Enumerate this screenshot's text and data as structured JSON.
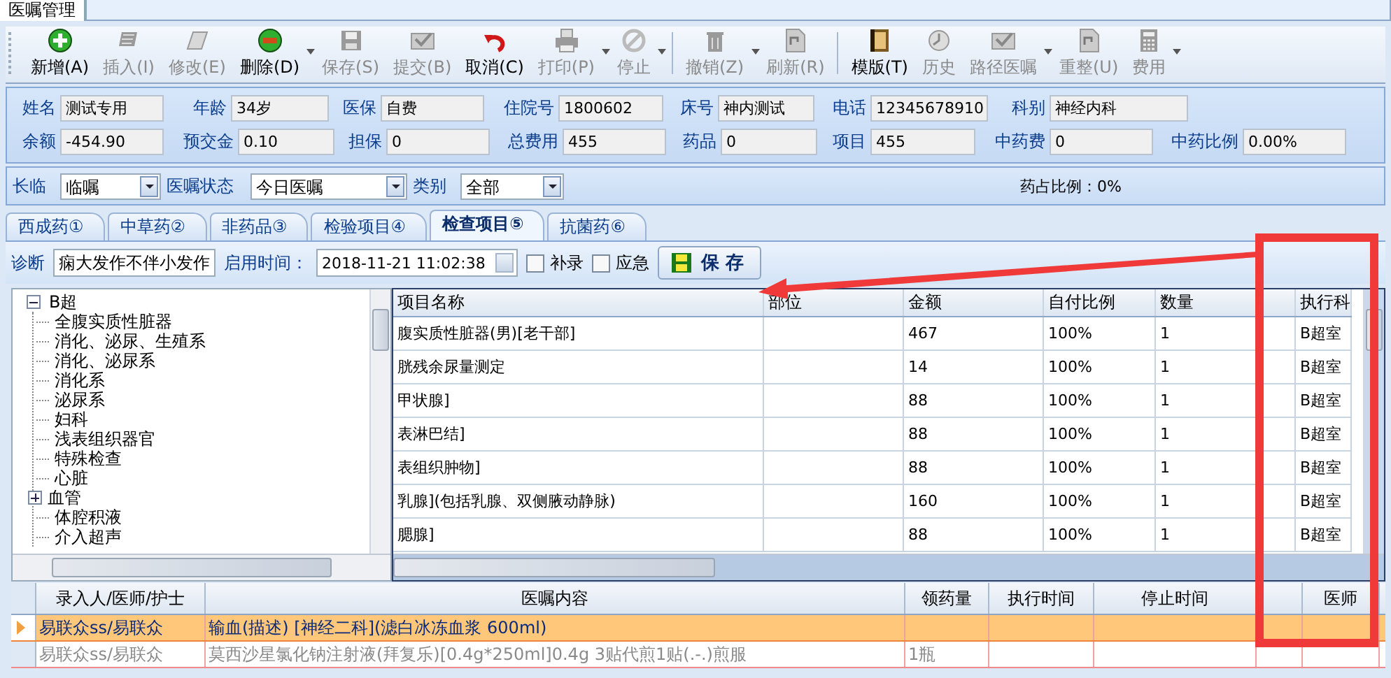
{
  "window": {
    "tab": "医嘱管理"
  },
  "toolbar": [
    {
      "label": "新增(A)",
      "disabled": false,
      "dropdown": false
    },
    {
      "label": "插入(I)",
      "disabled": true,
      "dropdown": false
    },
    {
      "label": "修改(E)",
      "disabled": true,
      "dropdown": false
    },
    {
      "label": "删除(D)",
      "disabled": false,
      "dropdown": true
    },
    {
      "label": "保存(S)",
      "disabled": true,
      "dropdown": false
    },
    {
      "label": "提交(B)",
      "disabled": true,
      "dropdown": false
    },
    {
      "label": "取消(C)",
      "disabled": false,
      "dropdown": false
    },
    {
      "label": "打印(P)",
      "disabled": true,
      "dropdown": true
    },
    {
      "label": "停止",
      "disabled": true,
      "dropdown": true
    },
    {
      "label": "撤销(Z)",
      "disabled": true,
      "dropdown": true
    },
    {
      "label": "刷新(R)",
      "disabled": true,
      "dropdown": false
    },
    {
      "label": "模版(T)",
      "disabled": false,
      "dropdown": false
    },
    {
      "label": "历史",
      "disabled": true,
      "dropdown": false
    },
    {
      "label": "路径医嘱",
      "disabled": true,
      "dropdown": true
    },
    {
      "label": "重整(U)",
      "disabled": true,
      "dropdown": false
    },
    {
      "label": "费用",
      "disabled": true,
      "dropdown": true
    }
  ],
  "patient": [
    [
      {
        "label": "姓名",
        "value": "测试专用"
      },
      {
        "label": "年龄",
        "value": "34岁"
      },
      {
        "label": "医保",
        "value": "自费"
      },
      {
        "label": "住院号",
        "value": "1800602"
      },
      {
        "label": "床号",
        "value": "神内测试"
      },
      {
        "label": "电话",
        "value": "12345678910"
      },
      {
        "label": "科别",
        "value": "神经内科"
      }
    ],
    [
      {
        "label": "余额",
        "value": "-454.90"
      },
      {
        "label": "预交金",
        "value": "0.10"
      },
      {
        "label": "担保",
        "value": "0"
      },
      {
        "label": "总费用",
        "value": "455"
      },
      {
        "label": "药品",
        "value": "0"
      },
      {
        "label": "项目",
        "value": "455"
      },
      {
        "label": "中药费",
        "value": "0"
      },
      {
        "label": "中药比例",
        "value": "0.00%"
      }
    ]
  ],
  "filters": [
    {
      "label": "长临",
      "value": "临嘱"
    },
    {
      "label": "医嘱状态",
      "value": "今日医嘱"
    },
    {
      "label": "类别",
      "value": "全部"
    }
  ],
  "drug_ratio": "药占比例：0%",
  "tabs": [
    {
      "label": "西成药①",
      "selected": false
    },
    {
      "label": "中草药②",
      "selected": false
    },
    {
      "label": "非药品③",
      "selected": false
    },
    {
      "label": "检验项目④",
      "selected": false
    },
    {
      "label": "检查项目⑤",
      "selected": true
    },
    {
      "label": "抗菌药⑥",
      "selected": false
    }
  ],
  "diagnosis": {
    "label": "诊断",
    "value": "痫大发作不伴小发作",
    "start_label": "启用时间：",
    "start_time": "2018-11-21 11:02:38",
    "checks": [
      {
        "label": "补录",
        "checked": false
      },
      {
        "label": "应急",
        "checked": false
      }
    ],
    "save": "保 存"
  },
  "tree": {
    "label": "B超",
    "expanded": true,
    "children": [
      {
        "label": "全腹实质性脏器"
      },
      {
        "label": "消化、泌尿、生殖系"
      },
      {
        "label": "消化、泌尿系"
      },
      {
        "label": "消化系"
      },
      {
        "label": "泌尿系"
      },
      {
        "label": "妇科"
      },
      {
        "label": "浅表组织器官"
      },
      {
        "label": "特殊检查"
      },
      {
        "label": "心脏"
      },
      {
        "label": "血管",
        "expanded": false
      },
      {
        "label": "体腔积液"
      },
      {
        "label": "介入超声"
      }
    ]
  },
  "table": {
    "columns": [
      "项目名称",
      "部位",
      "金额",
      "自付比例",
      "数量",
      "执行科"
    ],
    "rows": [
      {
        "cells": [
          "腹实质性脏器(男)[老干部]",
          "",
          "467",
          "100%",
          "1",
          "B超室"
        ]
      },
      {
        "cells": [
          "胱残余尿量测定",
          "",
          "14",
          "100%",
          "1",
          "B超室"
        ]
      },
      {
        "cells": [
          "甲状腺]",
          "",
          "88",
          "100%",
          "1",
          "B超室"
        ]
      },
      {
        "cells": [
          "表淋巴结]",
          "",
          "88",
          "100%",
          "1",
          "B超室"
        ]
      },
      {
        "cells": [
          "表组织肿物]",
          "",
          "88",
          "100%",
          "1",
          "B超室"
        ]
      },
      {
        "cells": [
          "乳腺](包括乳腺、双侧腋动静脉)",
          "",
          "160",
          "100%",
          "1",
          "B超室"
        ]
      },
      {
        "cells": [
          "腮腺]",
          "",
          "88",
          "100%",
          "1",
          "B超室"
        ]
      }
    ]
  },
  "orders": {
    "columns": [
      "录入人/医师/护士",
      "医嘱内容",
      "领药量",
      "执行时间",
      "停止时间",
      "医师"
    ],
    "rows": [
      {
        "cells": [
          "易联众ss/易联众",
          "输血(描述)    [神经二科](滤白冰冻血浆 600ml)"
        ],
        "selected": true,
        "dimmed": false
      },
      {
        "cells": [
          "易联众ss/易联众",
          "莫西沙星氯化钠注射液(拜复乐)[0.4g*250ml]0.4g 3贴代煎1贴(.-.)煎服",
          "1瓶"
        ],
        "selected": false,
        "dimmed": true
      }
    ]
  }
}
